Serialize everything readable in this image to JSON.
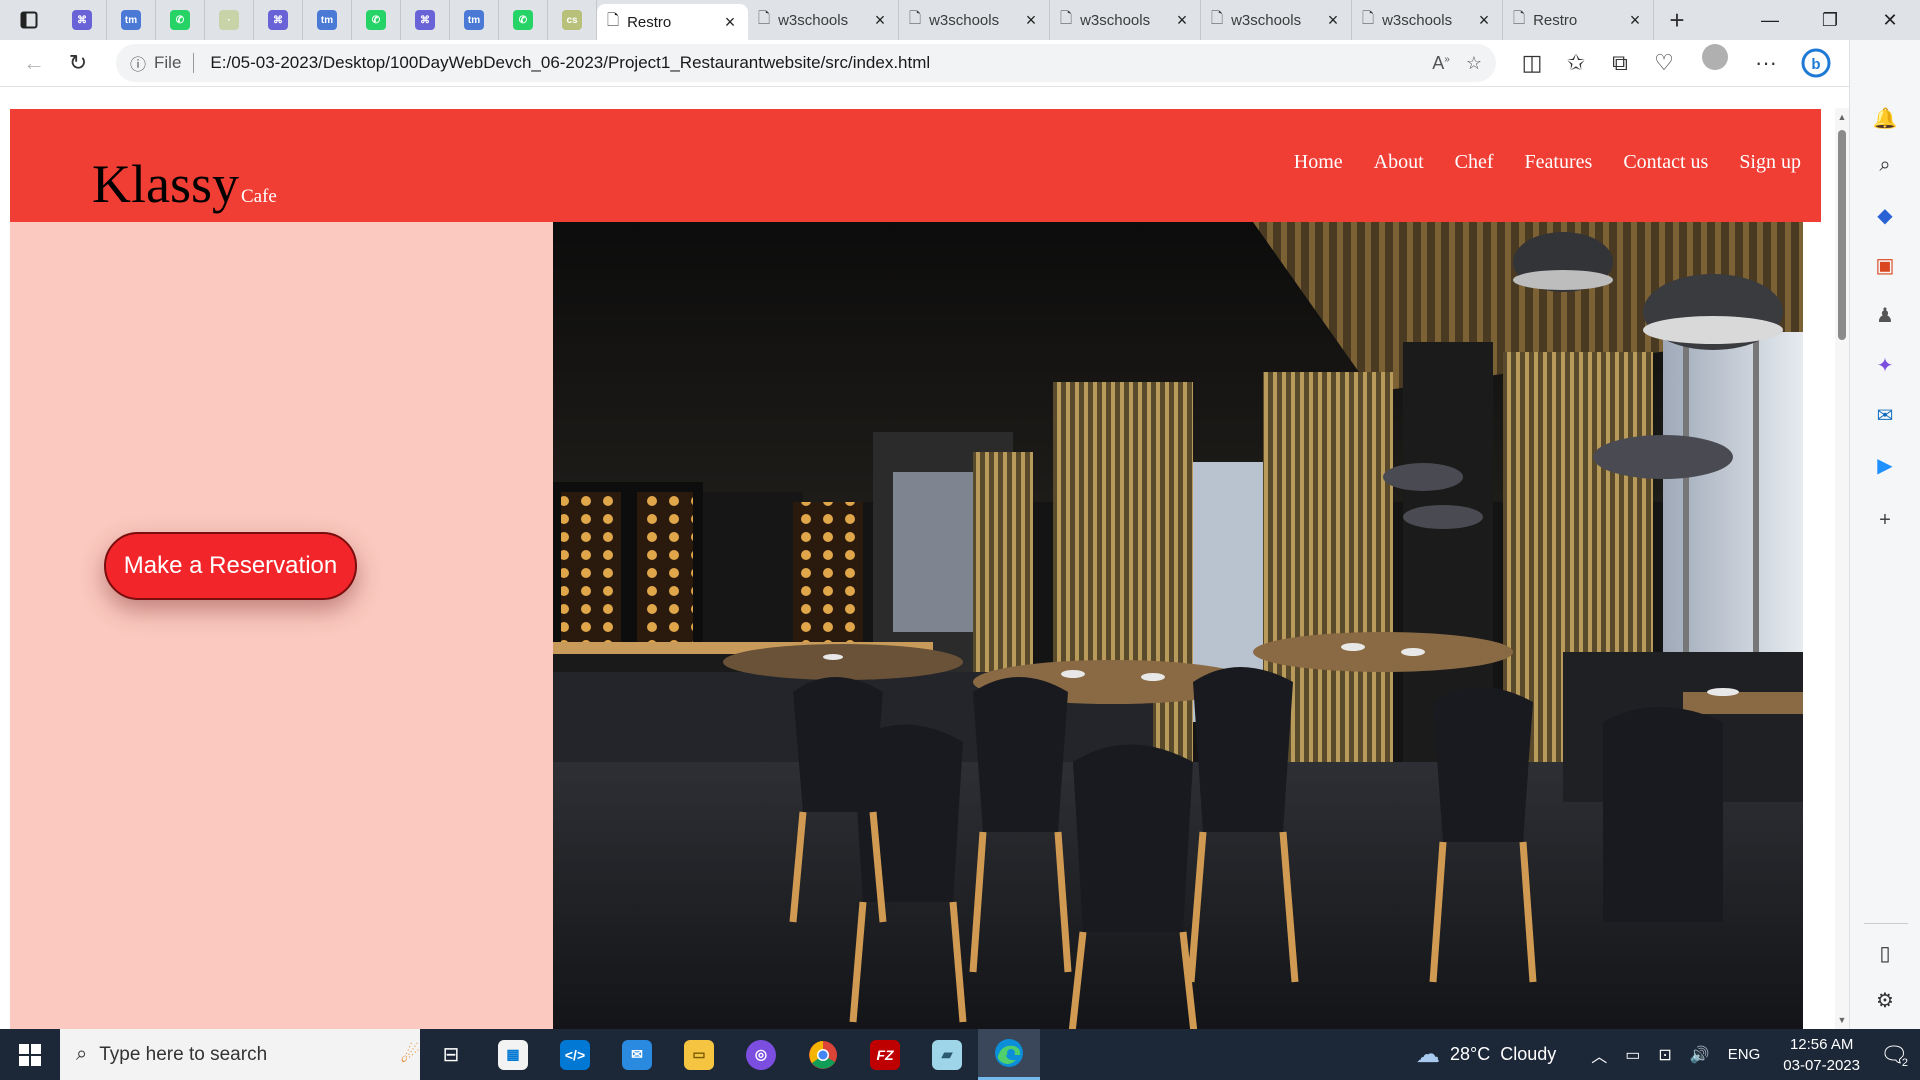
{
  "browser": {
    "pinned_tabs": [
      {
        "icon": "file-tab-icon",
        "color": "#6a63d8",
        "glyph": "⌘"
      },
      {
        "icon": "tm-icon",
        "color": "#4a7ad6",
        "glyph": "tm"
      },
      {
        "icon": "whatsapp-icon",
        "color": "#25d366",
        "glyph": "✆"
      },
      {
        "icon": "blank-tab-icon",
        "color": "#c9d3a8",
        "glyph": "·"
      },
      {
        "icon": "file-tab-icon",
        "color": "#6a63d8",
        "glyph": "⌘"
      },
      {
        "icon": "tm-icon",
        "color": "#4a7ad6",
        "glyph": "tm"
      },
      {
        "icon": "whatsapp-icon",
        "color": "#25d366",
        "glyph": "✆"
      },
      {
        "icon": "file-tab-icon",
        "color": "#6a63d8",
        "glyph": "⌘"
      },
      {
        "icon": "tm-icon",
        "color": "#4a7ad6",
        "glyph": "tm"
      },
      {
        "icon": "whatsapp-icon",
        "color": "#25d366",
        "glyph": "✆"
      },
      {
        "icon": "csv-icon",
        "color": "#b8c07a",
        "glyph": "cs"
      }
    ],
    "tabs": [
      {
        "label": "Restro",
        "active": true
      },
      {
        "label": "w3schools",
        "active": false
      },
      {
        "label": "w3schools",
        "active": false
      },
      {
        "label": "w3schools",
        "active": false
      },
      {
        "label": "w3schools",
        "active": false
      },
      {
        "label": "w3schools",
        "active": false
      },
      {
        "label": "Restro",
        "active": false
      }
    ],
    "address": {
      "scheme": "File",
      "url": "E:/05-03-2023/Desktop/100DayWebDevch_06-2023/Project1_Restaurantwebsite/src/index.html"
    }
  },
  "site": {
    "brand": {
      "name": "Klassy",
      "suffix": "Cafe"
    },
    "nav": [
      "Home",
      "About",
      "Chef",
      "Features",
      "Contact us",
      "Sign up"
    ],
    "cta": "Make a Reservation",
    "colors": {
      "header": "#f03e35",
      "hero_left": "#fbc9bf",
      "button": "#f2262a"
    }
  },
  "taskbar": {
    "search_placeholder": "Type here to search",
    "apps": [
      "task-view-icon",
      "microsoft-store-icon",
      "vscode-icon",
      "mail-icon",
      "file-explorer-icon",
      "github-desktop-icon",
      "chrome-icon",
      "filezilla-icon",
      "notes-icon",
      "edge-icon"
    ],
    "weather": {
      "temp": "28°C",
      "condition": "Cloudy"
    },
    "language": "ENG",
    "time": "12:56 AM",
    "date": "03-07-2023",
    "notifications": "2"
  }
}
